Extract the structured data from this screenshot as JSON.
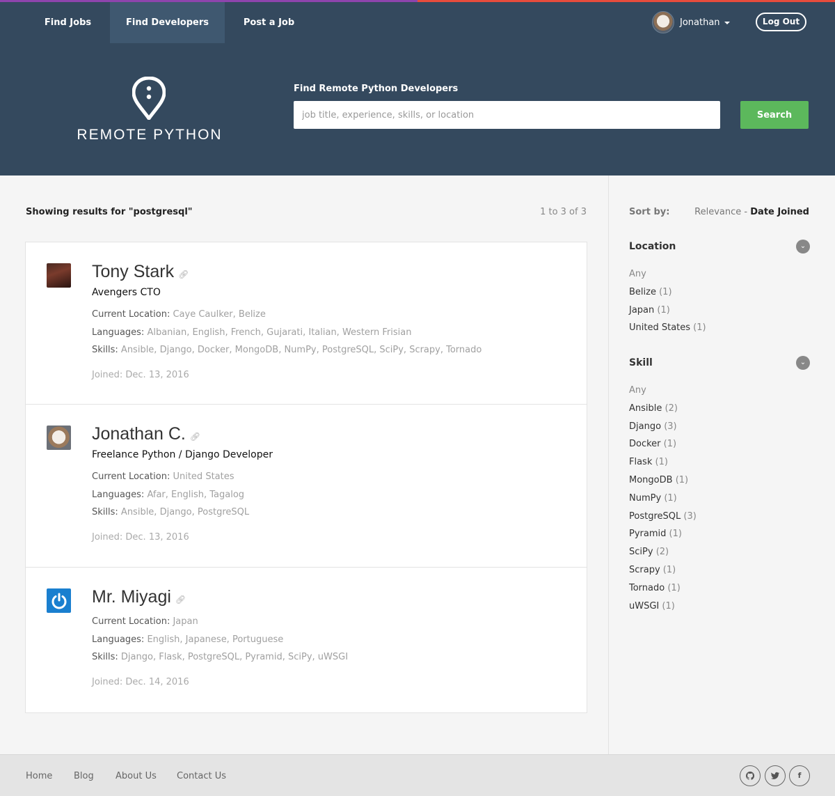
{
  "nav": {
    "items": [
      {
        "label": "Find Jobs"
      },
      {
        "label": "Find Developers"
      },
      {
        "label": "Post a Job"
      }
    ],
    "user_name": "Jonathan",
    "logout_label": "Log Out"
  },
  "hero": {
    "logo_text": "REMOTE PYTHON",
    "search_label": "Find Remote Python Developers",
    "search_placeholder": "job title, experience, skills, or location",
    "search_button": "Search"
  },
  "results": {
    "heading": "Showing results for \"postgresql\"",
    "count": "1 to 3 of 3",
    "items": [
      {
        "name": "Tony Stark",
        "title": "Avengers CTO",
        "location_label": "Current Location:",
        "location": "Caye Caulker, Belize",
        "languages_label": "Languages:",
        "languages": "Albanian, English, French, Gujarati, Italian, Western Frisian",
        "skills_label": "Skills:",
        "skills": "Ansible, Django, Docker, MongoDB, NumPy, PostgreSQL, SciPy, Scrapy, Tornado",
        "joined": "Joined: Dec. 13, 2016"
      },
      {
        "name": "Jonathan C.",
        "title": "Freelance Python / Django Developer",
        "location_label": "Current Location:",
        "location": "United States",
        "languages_label": "Languages:",
        "languages": "Afar, English, Tagalog",
        "skills_label": "Skills:",
        "skills": "Ansible, Django, PostgreSQL",
        "joined": "Joined: Dec. 13, 2016"
      },
      {
        "name": "Mr. Miyagi",
        "title": "",
        "location_label": "Current Location:",
        "location": "Japan",
        "languages_label": "Languages:",
        "languages": "English, Japanese, Portuguese",
        "skills_label": "Skills:",
        "skills": "Django, Flask, PostgreSQL, Pyramid, SciPy, uWSGI",
        "joined": "Joined: Dec. 14, 2016"
      }
    ]
  },
  "sidebar": {
    "sort_label": "Sort by:",
    "sort_relevance": "Relevance",
    "sort_separator": "-",
    "sort_date": "Date Joined",
    "location": {
      "title": "Location",
      "any": "Any",
      "items": [
        {
          "label": "Belize",
          "count": "(1)"
        },
        {
          "label": "Japan",
          "count": "(1)"
        },
        {
          "label": "United States",
          "count": "(1)"
        }
      ]
    },
    "skill": {
      "title": "Skill",
      "any": "Any",
      "items": [
        {
          "label": "Ansible",
          "count": "(2)"
        },
        {
          "label": "Django",
          "count": "(3)"
        },
        {
          "label": "Docker",
          "count": "(1)"
        },
        {
          "label": "Flask",
          "count": "(1)"
        },
        {
          "label": "MongoDB",
          "count": "(1)"
        },
        {
          "label": "NumPy",
          "count": "(1)"
        },
        {
          "label": "PostgreSQL",
          "count": "(3)"
        },
        {
          "label": "Pyramid",
          "count": "(1)"
        },
        {
          "label": "SciPy",
          "count": "(2)"
        },
        {
          "label": "Scrapy",
          "count": "(1)"
        },
        {
          "label": "Tornado",
          "count": "(1)"
        },
        {
          "label": "uWSGI",
          "count": "(1)"
        }
      ]
    }
  },
  "footer": {
    "links": [
      {
        "label": "Home"
      },
      {
        "label": "Blog"
      },
      {
        "label": "About Us"
      },
      {
        "label": "Contact Us"
      }
    ],
    "social": [
      {
        "icon": "github-icon"
      },
      {
        "icon": "twitter-icon"
      },
      {
        "icon": "facebook-icon",
        "glyph": "f"
      }
    ]
  },
  "colors": {
    "header_bg": "#34495e",
    "search_button": "#5cb85c",
    "stripe_left": "#8e44ad",
    "stripe_right": "#e74c3c"
  }
}
